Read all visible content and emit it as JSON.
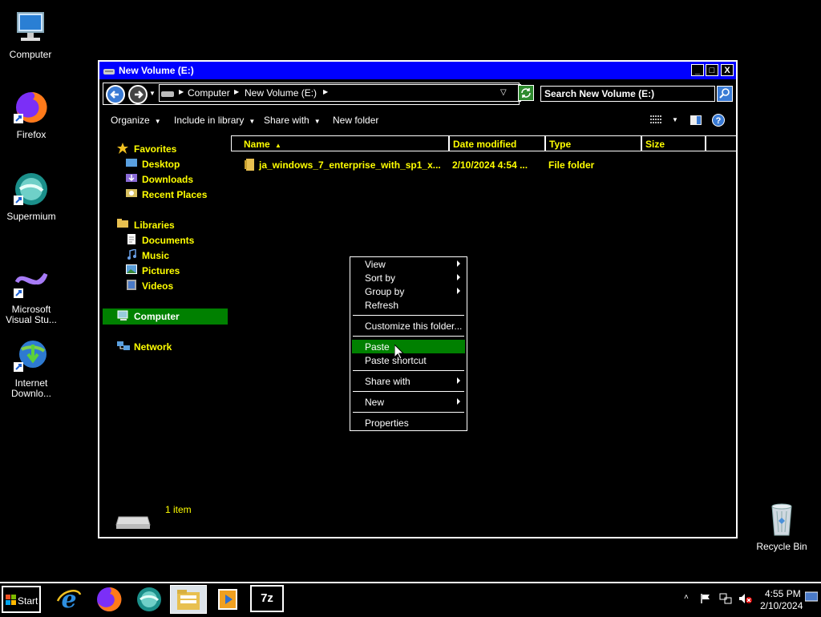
{
  "desktop": {
    "icons": [
      {
        "label": "Computer",
        "icon": "computer-icon"
      },
      {
        "label": "Firefox",
        "icon": "firefox-icon"
      },
      {
        "label": "Supermium",
        "icon": "supermium-icon"
      },
      {
        "label": "Microsoft Visual Stu...",
        "icon": "visual-studio-icon"
      },
      {
        "label": "Internet Downlo...",
        "icon": "internet-download-manager-icon"
      },
      {
        "label": "Recycle Bin",
        "icon": "recycle-bin-icon"
      }
    ]
  },
  "window": {
    "title": "New Volume (E:)",
    "controls": {
      "minimize": "_",
      "maximize": "□",
      "close": "X"
    },
    "address": {
      "segments": [
        "Computer",
        "New Volume (E:)"
      ]
    },
    "search": {
      "placeholder": "Search New Volume (E:)"
    },
    "toolbar": {
      "organize": "Organize",
      "include_in_library": "Include in library",
      "share_with": "Share with",
      "new_folder": "New folder"
    },
    "nav": {
      "favorites": "Favorites",
      "desktop": "Desktop",
      "downloads": "Downloads",
      "recent_places": "Recent Places",
      "libraries": "Libraries",
      "documents": "Documents",
      "music": "Music",
      "pictures": "Pictures",
      "videos": "Videos",
      "computer": "Computer",
      "network": "Network"
    },
    "columns": {
      "name": "Name",
      "date_modified": "Date modified",
      "type": "Type",
      "size": "Size"
    },
    "files": [
      {
        "name": "ja_windows_7_enterprise_with_sp1_x...",
        "date": "2/10/2024 4:54 ...",
        "type": "File folder",
        "size": ""
      }
    ],
    "status": {
      "item_count": "1 item"
    }
  },
  "context_menu": {
    "view": "View",
    "sort_by": "Sort by",
    "group_by": "Group by",
    "refresh": "Refresh",
    "customize": "Customize this folder...",
    "paste": "Paste",
    "paste_shortcut": "Paste shortcut",
    "share_with": "Share with",
    "new": "New",
    "properties": "Properties"
  },
  "taskbar": {
    "start": "Start",
    "clock": {
      "time": "4:55 PM",
      "date": "2/10/2024"
    },
    "seven_zip": "7z"
  },
  "colors": {
    "titlebar": "#0000ff",
    "highlight": "#008000",
    "nav_text": "#ffff00",
    "background": "#000000"
  }
}
